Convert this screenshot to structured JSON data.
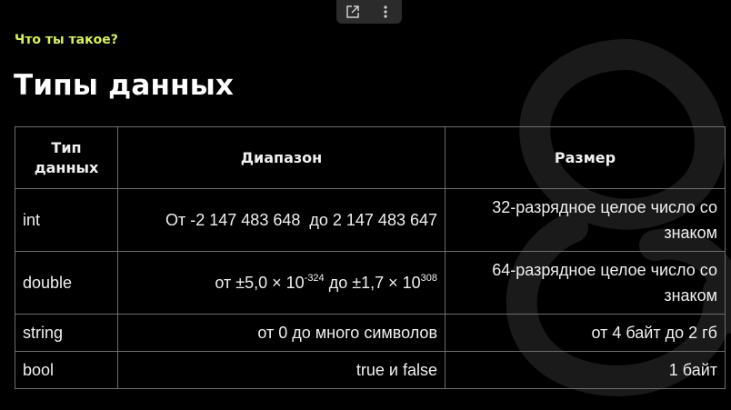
{
  "toolbar": {
    "open_icon": "external-link-icon",
    "more_icon": "more-vertical-icon"
  },
  "kicker": "Что ты такое?",
  "title": "Типы данных",
  "colors": {
    "accent": "#d7f44a",
    "background": "#000000",
    "text": "#ffffff",
    "border": "#6e6e6e"
  },
  "table": {
    "headers": [
      "Тип данных",
      "Диапазон",
      "Размер"
    ],
    "rows": [
      {
        "type": "int",
        "range": "От -2 147 483 648  до 2 147 483 647",
        "size": "32-разрядное целое число со знаком"
      },
      {
        "type": "double",
        "range_from": "от ±5,0 × 10",
        "range_from_exp": "-324",
        "range_to": " до ±1,7 × 10",
        "range_to_exp": "308",
        "size": "64-разрядное целое число со знаком"
      },
      {
        "type": "string",
        "range": "от 0 до много символов",
        "size": "от 4 байт до 2 гб"
      },
      {
        "type": "bool",
        "range": "true и false",
        "size": "1 байт"
      }
    ]
  }
}
